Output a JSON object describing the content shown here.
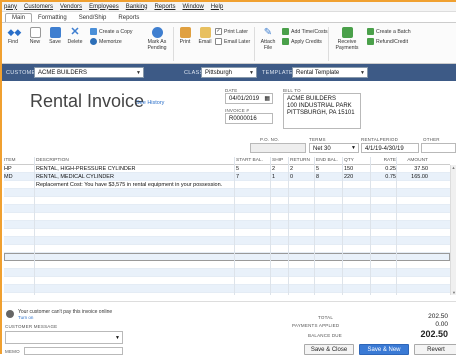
{
  "menu": [
    "pany",
    "Customers",
    "Vendors",
    "Employees",
    "Banking",
    "Reports",
    "Window",
    "Help"
  ],
  "ribbon_tabs": [
    "Main",
    "Formatting",
    "Send/Ship",
    "Reports"
  ],
  "ribbon": {
    "find": "Find",
    "new": "New",
    "save": "Save",
    "delete": "Delete",
    "create_copy": "Create a Copy",
    "memorize": "Memorize",
    "mark_pending": "Mark As Pending",
    "print": "Print",
    "email": "Email",
    "print_later": "Print Later",
    "email_later": "Email Later",
    "attach_file": "Attach File",
    "add_time_costs": "Add Time/Costs",
    "apply_credits": "Apply Credits",
    "receive_payments": "Receive Payments",
    "create_batch": "Create a Batch",
    "refund_credit": "Refund/Credit"
  },
  "custbar": {
    "customer_label": "CUSTOMER:JOB",
    "customer_value": "ACME BUILDERS",
    "class_label": "CLASS",
    "class_value": "Pittsburgh",
    "template_label": "TEMPLATE",
    "template_value": "Rental Template"
  },
  "form": {
    "title": "Rental Invoice",
    "see_history": "See History",
    "date_label": "DATE",
    "date_value": "04/01/2019",
    "invoice_label": "INVOICE #",
    "invoice_value": "R0000016",
    "bill_to_label": "BILL TO",
    "bill_to_lines": [
      "ACME BUILDERS",
      "100 INDUSTRIAL PARK",
      "PITTSBURGH, PA 15101"
    ],
    "po_label": "P.O. NO.",
    "po_value": "",
    "terms_label": "TERMS",
    "terms_value": "Net 30",
    "period_label": "RENTALPERIOD",
    "period_value": "4/1/19-4/30/19",
    "other_label": "OTHER",
    "other_value": ""
  },
  "grid": {
    "headers": [
      "ITEM",
      "DESCRIPTION",
      "START BAL.",
      "SHIP",
      "RETURN",
      "END BAL.",
      "QTY",
      "RATE",
      "AMOUNT"
    ],
    "rows": [
      [
        "HP",
        "RENTAL, HIGH-PRESSURE CYLINDER",
        "5",
        "2",
        "2",
        "5",
        "150",
        "0.25",
        "37.50"
      ],
      [
        "MD",
        "RENTAL, MEDICAL CYLINDER",
        "7",
        "1",
        "0",
        "8",
        "220",
        "0.75",
        "165.00"
      ],
      [
        "",
        "Replacement Cost: You have $3,575 in rental equipment in your possession.",
        "",
        "",
        "",
        "",
        "",
        "",
        ""
      ]
    ]
  },
  "bottom": {
    "online_note": "Your customer can't pay this invoice online",
    "turn_on": "Turn on",
    "customer_message_label": "CUSTOMER MESSAGE",
    "memo_label": "MEMO",
    "total_label": "TOTAL",
    "total_value": "202.50",
    "payments_label": "PAYMENTS APPLIED",
    "payments_value": "0.00",
    "balance_label": "BALANCE DUE",
    "balance_value": "202.50",
    "save_close": "Save & Close",
    "save_new": "Save & New",
    "revert": "Revert"
  },
  "colors": {
    "header_bar": "#3d5a86",
    "accent": "#2a6fc9",
    "save_new": "#3a7ad5",
    "frame": "#f0a030"
  }
}
